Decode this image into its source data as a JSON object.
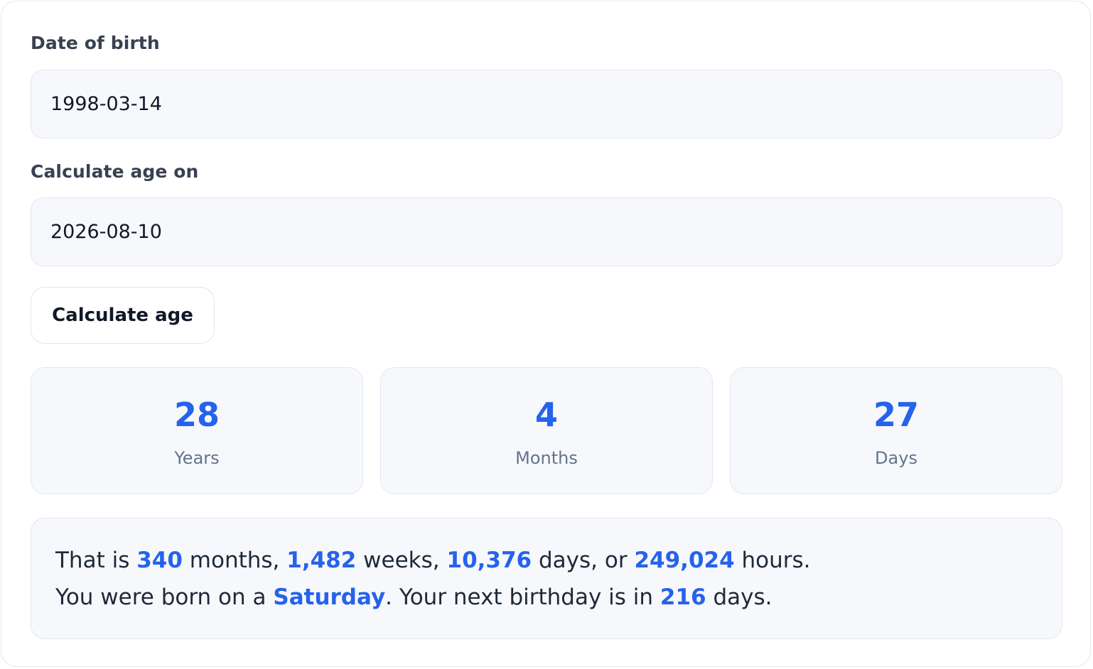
{
  "form": {
    "dob_label": "Date of birth",
    "dob_value": "1998-03-14",
    "target_label": "Calculate age on",
    "target_value": "2026-08-10",
    "button_label": "Calculate age"
  },
  "result": {
    "years": {
      "value": "28",
      "label": "Years"
    },
    "months": {
      "value": "4",
      "label": "Months"
    },
    "days": {
      "value": "27",
      "label": "Days"
    }
  },
  "summary": {
    "line1": {
      "t1": "That is ",
      "total_months": "340",
      "t2": " months, ",
      "total_weeks": "1,482",
      "t3": " weeks, ",
      "total_days": "10,376",
      "t4": " days, or ",
      "total_hours": "249,024",
      "t5": " hours."
    },
    "line2": {
      "t1": "You were born on a ",
      "weekday": "Saturday",
      "t2": ". Your next birthday is in ",
      "days_to_birthday": "216",
      "t3": " days."
    }
  },
  "colors": {
    "accent": "#2563eb",
    "label_text": "#374151",
    "muted_text": "#64748b",
    "panel_bg": "#f7f8fb",
    "border": "#e2e8f0"
  }
}
